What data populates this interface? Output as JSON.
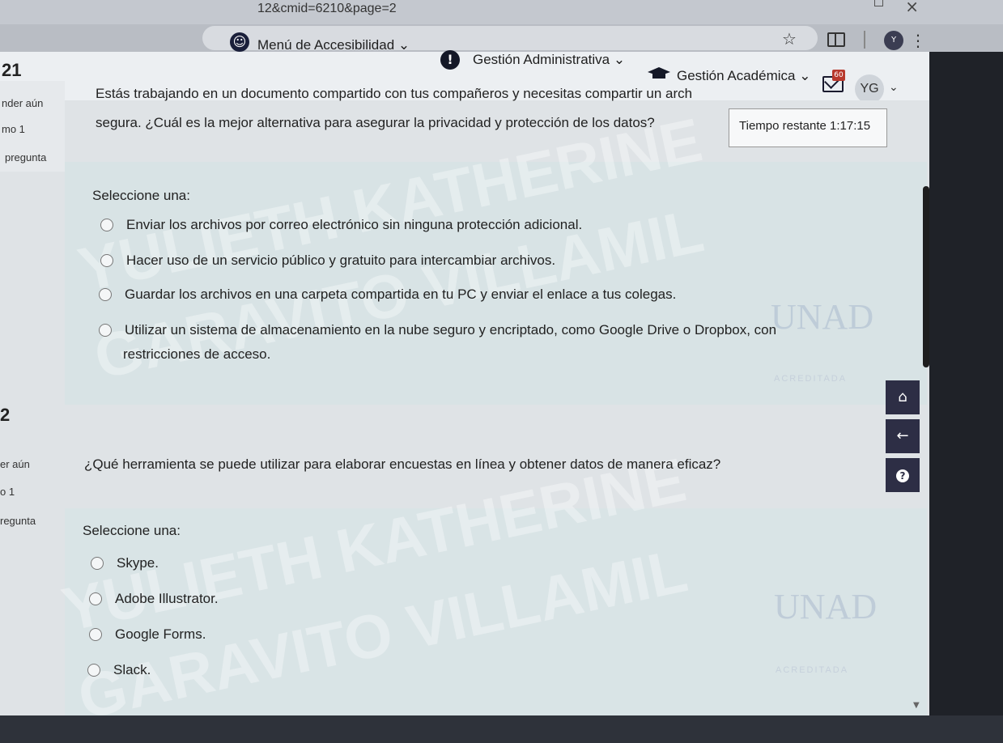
{
  "browser": {
    "url_fragment": "12&cmid=6210&page=2",
    "profile_initial": "Y"
  },
  "header": {
    "accessibility_menu": "Menú de Accesibilidad",
    "admin_menu": "Gestión Administrativa",
    "academic_menu": "Gestión Académica",
    "notif_count": "60",
    "avatar_initials": "YG"
  },
  "timer": {
    "label": "Tiempo restante 1:17:15"
  },
  "question1": {
    "number": "21",
    "side_status": "nder aún",
    "side_points": "mo 1",
    "side_flag": "pregunta",
    "text_line1": "Estás trabajando en un documento compartido con tus compañeros y necesitas compartir un arch",
    "text_line2": "segura. ¿Cuál es la mejor alternativa para asegurar la privacidad y protección de los datos?",
    "prompt": "Seleccione una:",
    "choices": [
      "Enviar los archivos por correo electrónico sin ninguna protección adicional.",
      "Hacer uso de un servicio público y gratuito para intercambiar archivos.",
      "Guardar los archivos en una carpeta compartida en tu PC y enviar el enlace a tus colegas.",
      "Utilizar un sistema de almacenamiento en la nube seguro y encriptado, como Google Drive o Dropbox, con",
      "restricciones de acceso."
    ]
  },
  "question2": {
    "number": "2",
    "side_status": "er aún",
    "side_points": "o 1",
    "side_flag": "regunta",
    "text": "¿Qué herramienta se puede utilizar para elaborar encuestas en línea y obtener datos de manera eficaz?",
    "prompt": "Seleccione una:",
    "choices": [
      "Skype.",
      "Adobe Illustrator.",
      "Google Forms.",
      "Slack."
    ]
  },
  "watermark": {
    "line1": "YULIETH KATHERINE",
    "line2": "GARAVITO VILLAMIL",
    "logo": "UNAD",
    "logo_sub": "ACREDITADA"
  },
  "fab": {
    "home_icon": "home-icon",
    "back_icon": "back-arrow-icon",
    "help_icon": "help-icon",
    "help_glyph": "?"
  }
}
